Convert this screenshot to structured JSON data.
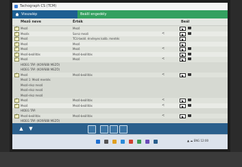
{
  "window": {
    "title": "Tachograph CS (TCM)"
  },
  "header": {
    "left_label": "Visszalép",
    "right_label": "Beállí engedély"
  },
  "columns": {
    "name": "Mező neve",
    "value": "Érték",
    "status": "Beál"
  },
  "rows": [
    {
      "name": "Mező",
      "value": "Mező",
      "status": "",
      "type": "alt",
      "checked": true,
      "play": true,
      "trash": true
    },
    {
      "name": "Mezős",
      "value": "Sorsz mező",
      "status": "<",
      "type": "plain",
      "checked": true,
      "play": true,
      "trash": true
    },
    {
      "name": "Mező",
      "value": "TCU-beáll. érvényes kalib. mentés",
      "status": "",
      "type": "alt",
      "checked": true,
      "play": true,
      "trash": false
    },
    {
      "name": "Mező",
      "value": "Mező",
      "status": "",
      "type": "plain",
      "checked": true,
      "play": true,
      "trash": false
    },
    {
      "name": "Mező",
      "value": "Mező",
      "status": "<",
      "type": "alt",
      "checked": true,
      "play": true,
      "trash": true
    },
    {
      "name": "Mező-beállítás",
      "value": "Mező-beállítás",
      "status": "",
      "type": "plain",
      "checked": true,
      "play": true,
      "trash": true
    },
    {
      "name": "Mező",
      "value": "Mező",
      "status": "<",
      "type": "alt",
      "checked": true,
      "play": true,
      "trash": true
    },
    {
      "name": "HIDEG TÁP. (KORÁBBI MEZŐ)",
      "value": "",
      "status": "",
      "type": "sub",
      "checked": false,
      "play": false,
      "trash": false
    },
    {
      "name": "HIDEG TÁP. (KORÁBBI MEZŐ)",
      "value": "",
      "status": "",
      "type": "sub",
      "checked": false,
      "play": false,
      "trash": false
    },
    {
      "name": "Mező",
      "value": "Mező-beállítás",
      "status": "<",
      "type": "alt",
      "checked": true,
      "play": true,
      "trash": true
    },
    {
      "name": "Mező 1: Mező mentés",
      "value": "",
      "status": "",
      "type": "sub",
      "checked": false,
      "play": false,
      "trash": false
    },
    {
      "name": "Mező-rész mező",
      "value": "",
      "status": "",
      "type": "sub",
      "checked": false,
      "play": false,
      "trash": false
    },
    {
      "name": "Mező-rész mező",
      "value": "",
      "status": "",
      "type": "sub",
      "checked": false,
      "play": false,
      "trash": false
    },
    {
      "name": "Mező-rész mező",
      "value": "",
      "status": "",
      "type": "sub",
      "checked": false,
      "play": false,
      "trash": false
    },
    {
      "name": "Mező",
      "value": "Mező-beállítás",
      "status": "<",
      "type": "alt",
      "checked": true,
      "play": true,
      "trash": true
    },
    {
      "name": "Mező",
      "value": "Mező-beállítás",
      "status": "<",
      "type": "plain",
      "checked": true,
      "play": true,
      "trash": true
    },
    {
      "name": "HIDEG TÁP.",
      "value": "",
      "status": "",
      "type": "sub",
      "checked": false,
      "play": false,
      "trash": false
    },
    {
      "name": "Mező-beállítás",
      "value": "Mező-beállítás",
      "status": "<",
      "type": "alt",
      "checked": true,
      "play": true,
      "trash": true
    },
    {
      "name": "HIDEG TÁP. (KORÁBBI MEZŐ)",
      "value": "",
      "status": "",
      "type": "sub",
      "checked": false,
      "play": false,
      "trash": false
    }
  ],
  "toolbar": {
    "up_icon": "arrow-up-icon",
    "down_icon": "arrow-down-icon",
    "print_icon": "printer-icon",
    "back_icon": "back-icon",
    "save_icon": "save-icon",
    "grid_icon": "grid-icon"
  },
  "taskbar": {
    "tray_text": "▲ ☁ ENG 12:00"
  },
  "colors": {
    "header_blue": "#1e5f92",
    "header_green": "#33a060",
    "toolbar_blue": "#2a5f8c"
  }
}
